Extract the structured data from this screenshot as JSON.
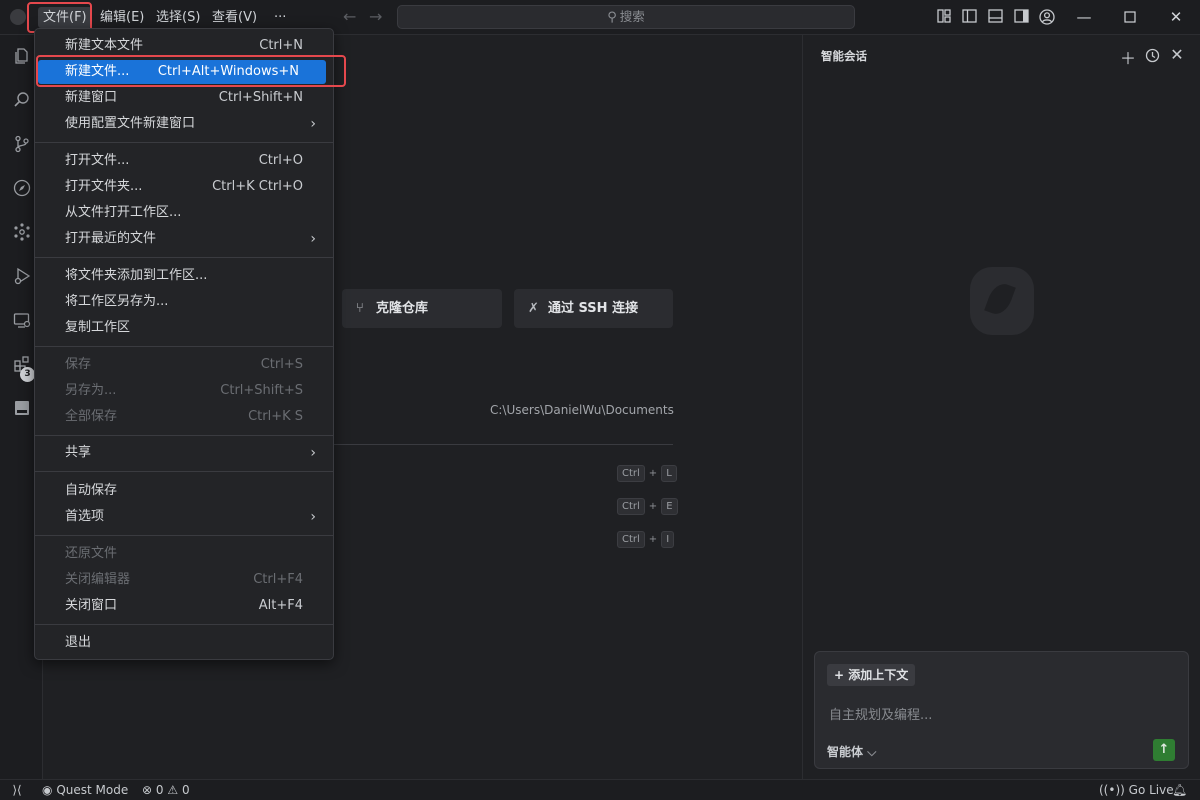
{
  "menubar": {
    "items": [
      "文件(F)",
      "编辑(E)",
      "选择(S)",
      "查看(V)"
    ],
    "more": "···"
  },
  "search": {
    "label": "搜索"
  },
  "activity_badge": "3",
  "file_menu": {
    "groups": [
      [
        {
          "label": "新建文本文件",
          "key": "Ctrl+N"
        },
        {
          "label": "新建文件...",
          "key": "Ctrl+Alt+Windows+N"
        },
        {
          "label": "新建窗口",
          "key": "Ctrl+Shift+N"
        },
        {
          "label": "使用配置文件新建窗口",
          "key": ""
        }
      ],
      [
        {
          "label": "打开文件...",
          "key": "Ctrl+O"
        },
        {
          "label": "打开文件夹...",
          "key": "Ctrl+K Ctrl+O"
        },
        {
          "label": "从文件打开工作区...",
          "key": ""
        },
        {
          "label": "打开最近的文件",
          "key": ""
        }
      ],
      [
        {
          "label": "将文件夹添加到工作区...",
          "key": ""
        },
        {
          "label": "将工作区另存为...",
          "key": ""
        },
        {
          "label": "复制工作区",
          "key": ""
        }
      ],
      [
        {
          "label": "保存",
          "key": "Ctrl+S"
        },
        {
          "label": "另存为...",
          "key": "Ctrl+Shift+S"
        },
        {
          "label": "全部保存",
          "key": "Ctrl+K S"
        }
      ],
      [
        {
          "label": "共享",
          "key": ""
        }
      ],
      [
        {
          "label": "自动保存",
          "key": ""
        },
        {
          "label": "首选项",
          "key": ""
        }
      ],
      [
        {
          "label": "还原文件",
          "key": ""
        },
        {
          "label": "关闭编辑器",
          "key": "Ctrl+F4"
        },
        {
          "label": "关闭窗口",
          "key": "Alt+F4"
        }
      ],
      [
        {
          "label": "退出",
          "key": ""
        }
      ]
    ]
  },
  "editor": {
    "clone_repo": "克隆仓库",
    "ssh_connect": "通过 SSH 连接",
    "recent_path": "C:\\Users\\DanielWu\\Documents",
    "shortcuts": [
      {
        "mod": "Ctrl",
        "plus": "+",
        "key": "L"
      },
      {
        "mod": "Ctrl",
        "plus": "+",
        "key": "E"
      },
      {
        "mod": "Ctrl",
        "plus": "+",
        "key": "I"
      }
    ]
  },
  "chat": {
    "title": "智能会话",
    "add_context": "添加上下文",
    "placeholder": "自主规划及编程...",
    "agent": "智能体"
  },
  "statusbar": {
    "quest_mode": "Quest Mode",
    "errors": "0",
    "warnings": "0",
    "go_live": "Go Live"
  }
}
